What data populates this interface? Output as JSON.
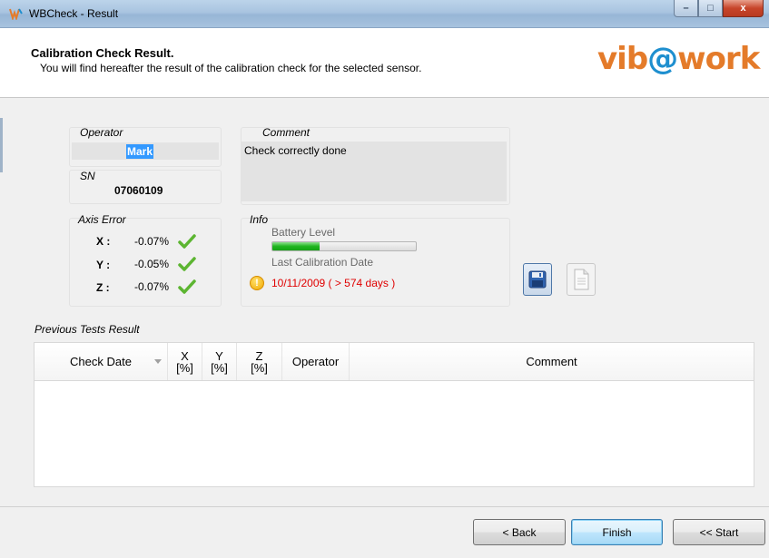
{
  "window": {
    "title": "WBCheck - Result",
    "controls": {
      "minimize": "–",
      "maximize": "□",
      "close": "x"
    }
  },
  "header": {
    "title": "Calibration Check Result.",
    "subtitle": "You will find hereafter the result of the calibration check for the selected sensor.",
    "logo": {
      "part1": "vib",
      "part2": "@",
      "part3": "work"
    }
  },
  "operator": {
    "label": "Operator",
    "value": "Mark"
  },
  "sn": {
    "label": "SN",
    "value": "07060109"
  },
  "comment": {
    "label": "Comment",
    "value": "Check correctly done"
  },
  "axis_error": {
    "label": "Axis Error",
    "rows": [
      {
        "axis": "X :",
        "value": "-0.07%"
      },
      {
        "axis": "Y :",
        "value": "-0.05%"
      },
      {
        "axis": "Z :",
        "value": "-0.07%"
      }
    ]
  },
  "info": {
    "label": "Info",
    "battery_label": "Battery Level",
    "battery_level": 0.33,
    "calibration_label": "Last Calibration Date",
    "calibration_value": "10/11/2009 ( > 574 days )",
    "warning_icon": "warning-icon",
    "warning_color": "#e00000"
  },
  "actions": {
    "save_icon": "floppy-disk-icon",
    "report_icon": "document-icon"
  },
  "previous_tests": {
    "label": "Previous Tests Result",
    "columns": [
      "Check Date",
      "X\n[%]",
      "Y\n[%]",
      "Z\n[%]",
      "Operator",
      "Comment"
    ],
    "rows": []
  },
  "footer": {
    "back": "< Back",
    "finish": "Finish",
    "start": "<< Start"
  },
  "colors": {
    "accent": "#3399ff",
    "logo_orange": "#e47b2a",
    "logo_blue": "#1e8fcf",
    "ok_green": "#5cb531"
  }
}
